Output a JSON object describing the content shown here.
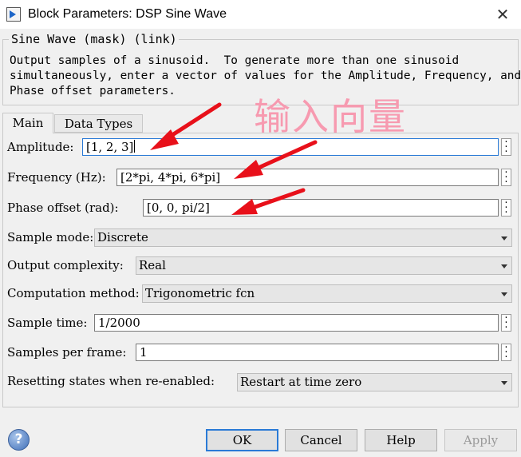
{
  "window": {
    "title": "Block Parameters: DSP Sine Wave",
    "close_glyph": "✕"
  },
  "group": {
    "title": "Sine Wave (mask) (link)",
    "description": "Output samples of a sinusoid.  To generate more than one sinusoid\nsimultaneously, enter a vector of values for the Amplitude, Frequency, and\nPhase offset parameters."
  },
  "annotation": "输入向量",
  "tabs": [
    {
      "label": "Main",
      "active": true
    },
    {
      "label": "Data Types",
      "active": false
    }
  ],
  "params": {
    "amplitude": {
      "label": "Amplitude:",
      "value": "[1, 2, 3]"
    },
    "frequency": {
      "label": "Frequency (Hz):",
      "value": "[2*pi, 4*pi, 6*pi]"
    },
    "phase": {
      "label": "Phase offset (rad):",
      "value": "[0, 0, pi/2]"
    },
    "sample_mode": {
      "label": "Sample mode:",
      "value": "Discrete"
    },
    "output_complexity": {
      "label": "Output complexity:",
      "value": "Real"
    },
    "computation_method": {
      "label": "Computation method:",
      "value": "Trigonometric fcn"
    },
    "sample_time": {
      "label": "Sample time:",
      "value": "1/2000"
    },
    "samples_per_frame": {
      "label": "Samples per frame:",
      "value": "1"
    },
    "resetting_states": {
      "label": "Resetting states when re-enabled:",
      "value": "Restart at time zero"
    }
  },
  "buttons": {
    "ok": "OK",
    "cancel": "Cancel",
    "help": "Help",
    "apply": "Apply"
  },
  "help_glyph": "?",
  "colors": {
    "annotation": "#f79ab0",
    "arrow": "#e8101a",
    "focus_border": "#2a7ad6"
  }
}
